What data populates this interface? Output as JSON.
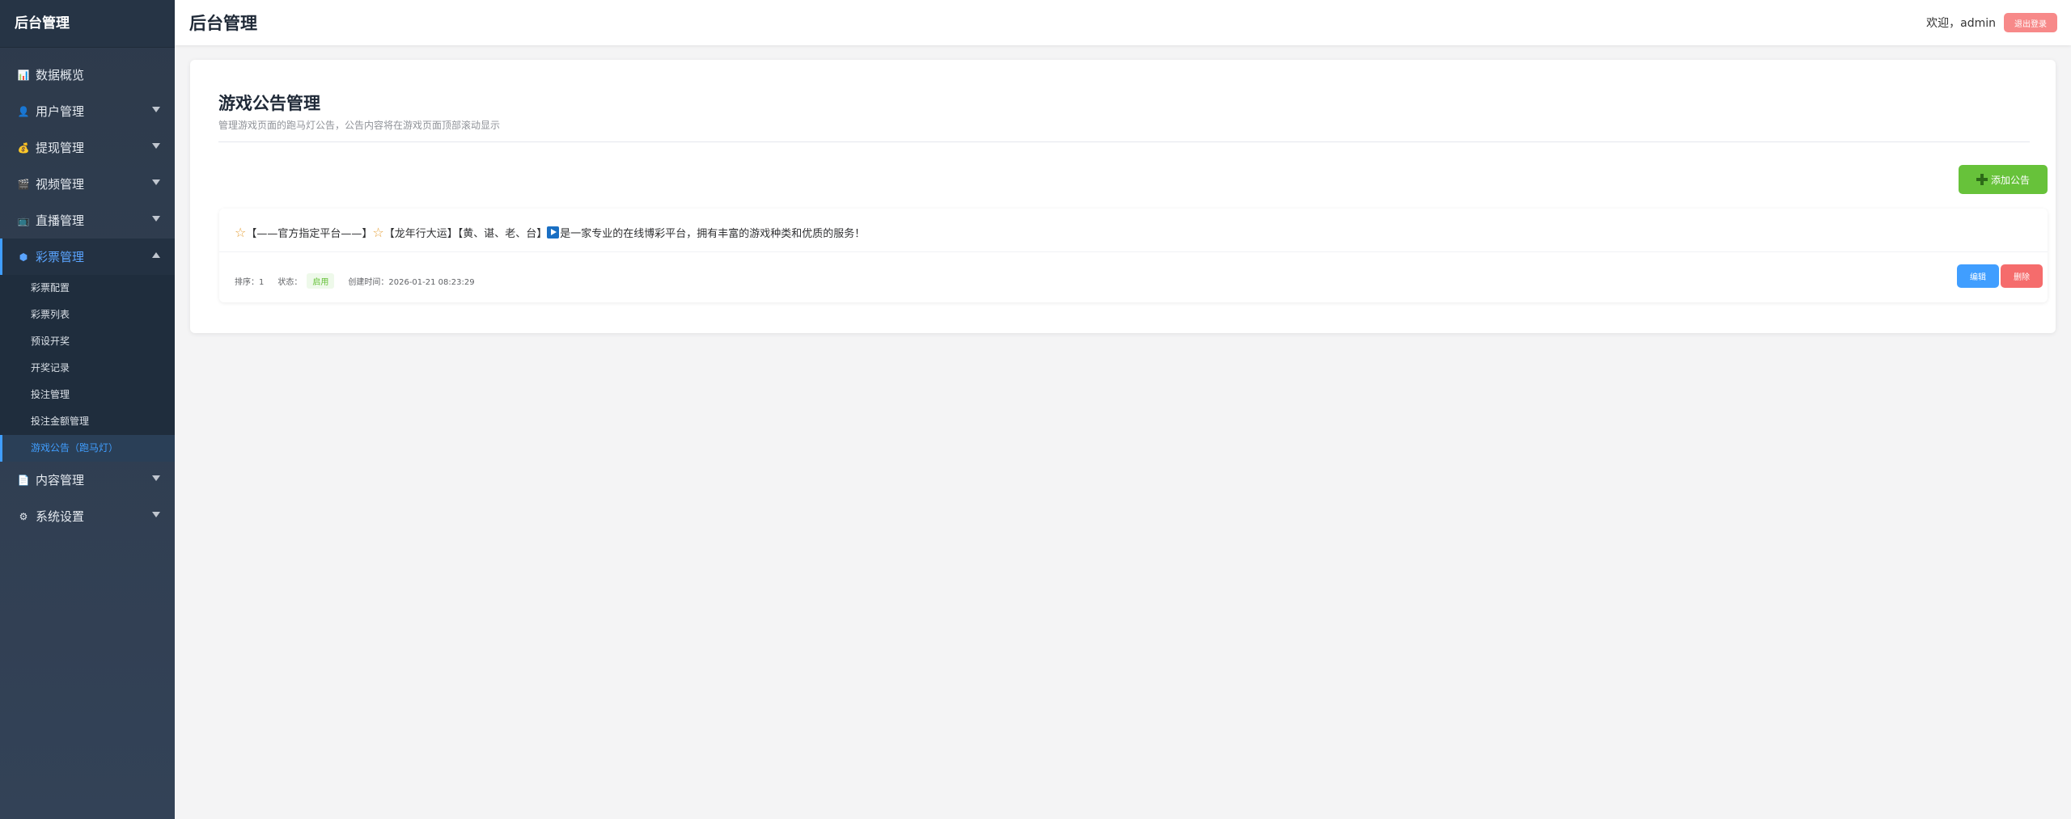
{
  "sidebar": {
    "brand": "后台管理",
    "menu": [
      {
        "label": "数据概览",
        "icon": "chart-icon"
      },
      {
        "label": "用户管理",
        "icon": "user-icon"
      },
      {
        "label": "提现管理",
        "icon": "money-bag-icon"
      },
      {
        "label": "视频管理",
        "icon": "film-icon"
      },
      {
        "label": "直播管理",
        "icon": "tv-icon"
      },
      {
        "label": "彩票管理",
        "icon": "dice-icon"
      },
      {
        "label": "内容管理",
        "icon": "document-icon"
      },
      {
        "label": "系统设置",
        "icon": "gear-icon"
      }
    ],
    "lottery_submenu": [
      "彩票配置",
      "彩票列表",
      "预设开奖",
      "开奖记录",
      "投注管理",
      "投注金额管理",
      "游戏公告（跑马灯）"
    ]
  },
  "header": {
    "title": "后台管理",
    "welcome": "欢迎，admin",
    "logout_label": "退出登录"
  },
  "page": {
    "title": "游戏公告管理",
    "description": "管理游戏页面的跑马灯公告，公告内容将在游戏页面顶部滚动显示",
    "add_label": "添加公告"
  },
  "notices": [
    {
      "content_parts": [
        "【——官方指定平台——】",
        "【龙年行大运】【黄、谌、老、台】",
        "是一家专业的在线博彩平台，拥有丰富的游戏种类和优质的服务！"
      ],
      "sort_label": "排序：1",
      "status_label": "状态：",
      "status_value": "启用",
      "created_label": "创建时间：2026-01-21 08:23:29",
      "edit_label": "编辑",
      "delete_label": "删除"
    }
  ],
  "colors": {
    "sidebar_bg": "#2d3a4b",
    "active_blue": "#409eff",
    "success_green": "#67c23a",
    "danger_red": "#f56c6c"
  }
}
